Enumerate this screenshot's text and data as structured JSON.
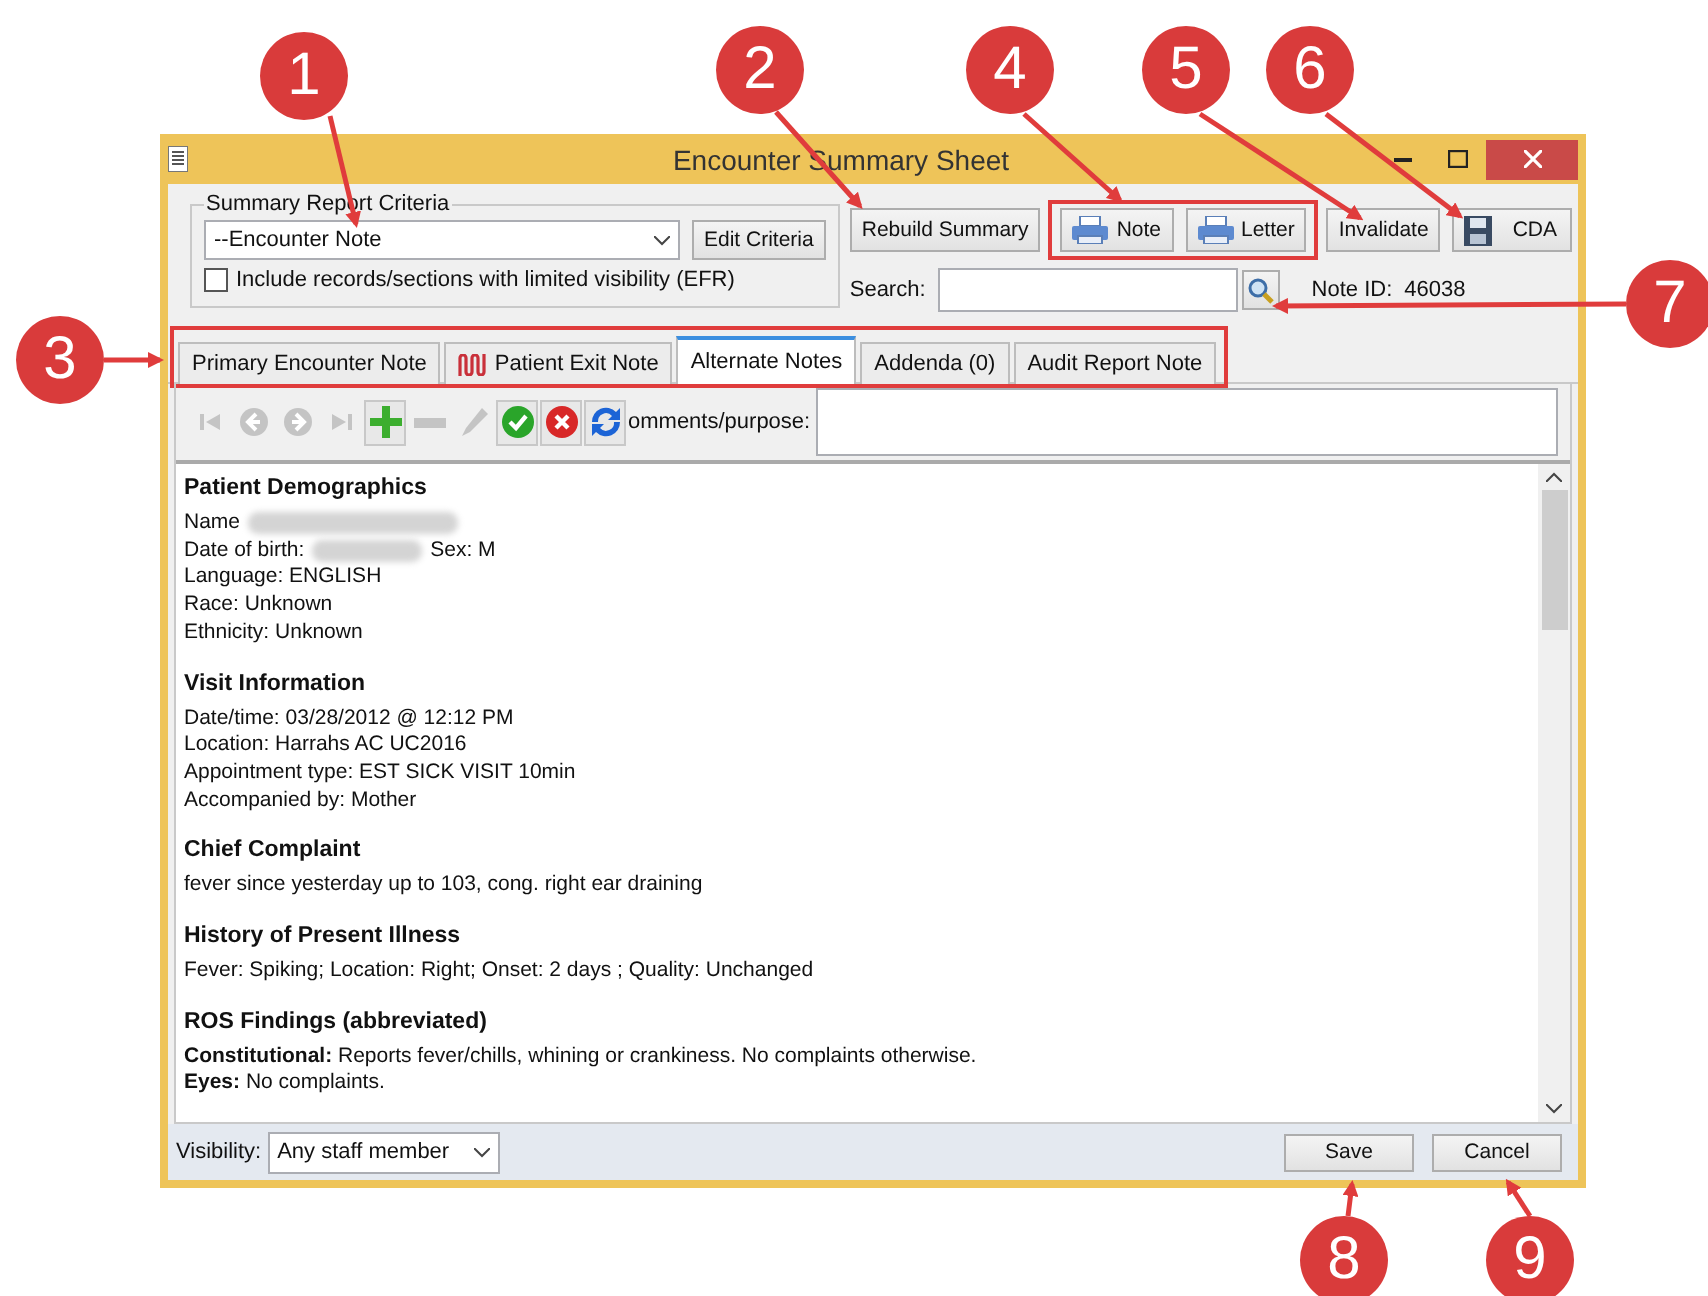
{
  "window": {
    "title": "Encounter Summary Sheet"
  },
  "criteria": {
    "legend": "Summary Report Criteria",
    "select_value": "--Encounter Note",
    "edit_button": "Edit Criteria",
    "checkbox_label": "Include records/sections with limited visibility (EFR)",
    "checked": false
  },
  "actions": [
    {
      "label": "Rebuild Summary",
      "kind": "plain",
      "highlight": false
    },
    {
      "label": "Note",
      "kind": "print",
      "highlight": true
    },
    {
      "label": "Letter",
      "kind": "print",
      "highlight": true
    },
    {
      "label": "Invalidate",
      "kind": "plain",
      "highlight": false
    },
    {
      "label": "CDA",
      "kind": "save",
      "highlight": false
    }
  ],
  "search": {
    "label": "Search:"
  },
  "note_id": {
    "label": "Note ID:",
    "value": "46038"
  },
  "tabs": [
    {
      "label": "Primary Encounter Note",
      "selected": false,
      "kind": "plain"
    },
    {
      "label": "Patient Exit Note",
      "selected": false,
      "kind": "exit"
    },
    {
      "label": "Alternate Notes",
      "selected": true,
      "kind": "plain"
    },
    {
      "label": "Addenda (0)",
      "selected": false,
      "kind": "plain"
    },
    {
      "label": "Audit Report Note",
      "selected": false,
      "kind": "plain"
    }
  ],
  "toolbar": [
    {
      "kind": "first",
      "disabled": true
    },
    {
      "kind": "prev",
      "disabled": true
    },
    {
      "kind": "next",
      "disabled": true
    },
    {
      "kind": "last",
      "disabled": true
    },
    {
      "kind": "add",
      "disabled": false
    },
    {
      "kind": "remove",
      "disabled": true
    },
    {
      "kind": "edit",
      "disabled": true
    },
    {
      "kind": "accept",
      "disabled": false
    },
    {
      "kind": "reject",
      "disabled": false
    },
    {
      "kind": "refresh",
      "disabled": false
    }
  ],
  "comments": {
    "label": "omments/purpose:"
  },
  "document": [
    {
      "heading": "Patient Demographics",
      "lines": [
        {
          "kind": "redacted",
          "text": "Name"
        },
        {
          "kind": "redacted",
          "text": "Date of birth:",
          "after": "Sex: M"
        },
        {
          "kind": "plain",
          "text": "Language: ENGLISH"
        },
        {
          "kind": "plain",
          "text": "Race: Unknown"
        },
        {
          "kind": "plain",
          "text": "Ethnicity: Unknown"
        }
      ]
    },
    {
      "heading": "Visit Information",
      "lines": [
        {
          "kind": "plain",
          "text": "Date/time: 03/28/2012 @ 12:12 PM"
        },
        {
          "kind": "plain",
          "text": "Location: Harrahs AC UC2016"
        },
        {
          "kind": "plain",
          "text": "Appointment type: EST SICK VISIT 10min"
        },
        {
          "kind": "plain",
          "text": "Accompanied by: Mother"
        }
      ]
    },
    {
      "heading": "Chief Complaint",
      "lines": [
        {
          "kind": "plain",
          "text": "fever since yesterday up to 103, cong. right ear draining"
        }
      ]
    },
    {
      "heading": "History of Present Illness",
      "lines": [
        {
          "kind": "plain",
          "text": "Fever: Spiking; Location: Right; Onset: 2 days ; Quality: Unchanged"
        }
      ]
    },
    {
      "heading": "ROS Findings (abbreviated)",
      "lines": [
        {
          "kind": "plain",
          "text": "**Constitutional:** Reports fever/chills, whining or crankiness. No complaints otherwise."
        },
        {
          "kind": "plain",
          "text": "**Eyes:** No complaints."
        }
      ]
    }
  ],
  "footer": {
    "visibility_label": "Visibility:",
    "visibility_value": "Any staff member",
    "save": "Save",
    "cancel": "Cancel"
  },
  "callouts": [
    "1",
    "2",
    "3",
    "4",
    "5",
    "6",
    "7",
    "8",
    "9"
  ]
}
